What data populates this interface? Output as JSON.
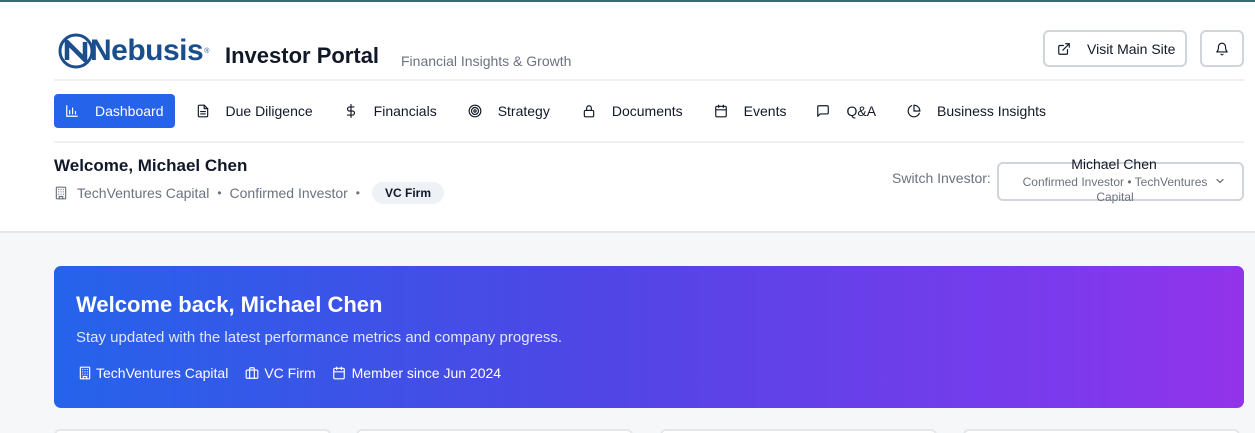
{
  "brand": {
    "logo_text": "Nebusis",
    "logo_mark": "®",
    "colors": {
      "logo": "#1a4e8c",
      "accent": "#2563eb",
      "gradient_start": "#2563eb",
      "gradient_end": "#9333ea"
    }
  },
  "header": {
    "title": "Investor Portal",
    "subtitle": "Financial Insights & Growth",
    "visit_site_label": "Visit Main Site",
    "visit_site_icon": "external-link-icon",
    "notifications_icon": "bell-icon"
  },
  "nav": {
    "tabs": [
      {
        "label": "Dashboard",
        "icon": "bar-chart-icon",
        "active": true
      },
      {
        "label": "Due Diligence",
        "icon": "file-text-icon",
        "active": false
      },
      {
        "label": "Financials",
        "icon": "dollar-icon",
        "active": false
      },
      {
        "label": "Strategy",
        "icon": "target-icon",
        "active": false
      },
      {
        "label": "Documents",
        "icon": "lock-icon",
        "active": false
      },
      {
        "label": "Events",
        "icon": "calendar-icon",
        "active": false
      },
      {
        "label": "Q&A",
        "icon": "message-square-icon",
        "active": false
      },
      {
        "label": "Business Insights",
        "icon": "pie-chart-icon",
        "active": false
      }
    ]
  },
  "investor": {
    "welcome": "Welcome, Michael Chen",
    "company": "TechVentures Capital",
    "status": "Confirmed Investor",
    "separator": "•",
    "badge": "VC Firm"
  },
  "switcher": {
    "label": "Switch Investor:",
    "selected_name": "Michael Chen",
    "selected_detail": "Confirmed Investor • TechVentures Capital"
  },
  "banner": {
    "title": "Welcome back, Michael Chen",
    "text": "Stay updated with the latest performance metrics and company progress.",
    "company": "TechVentures Capital",
    "type": "VC Firm",
    "member_since": "Member since Jun 2024"
  }
}
